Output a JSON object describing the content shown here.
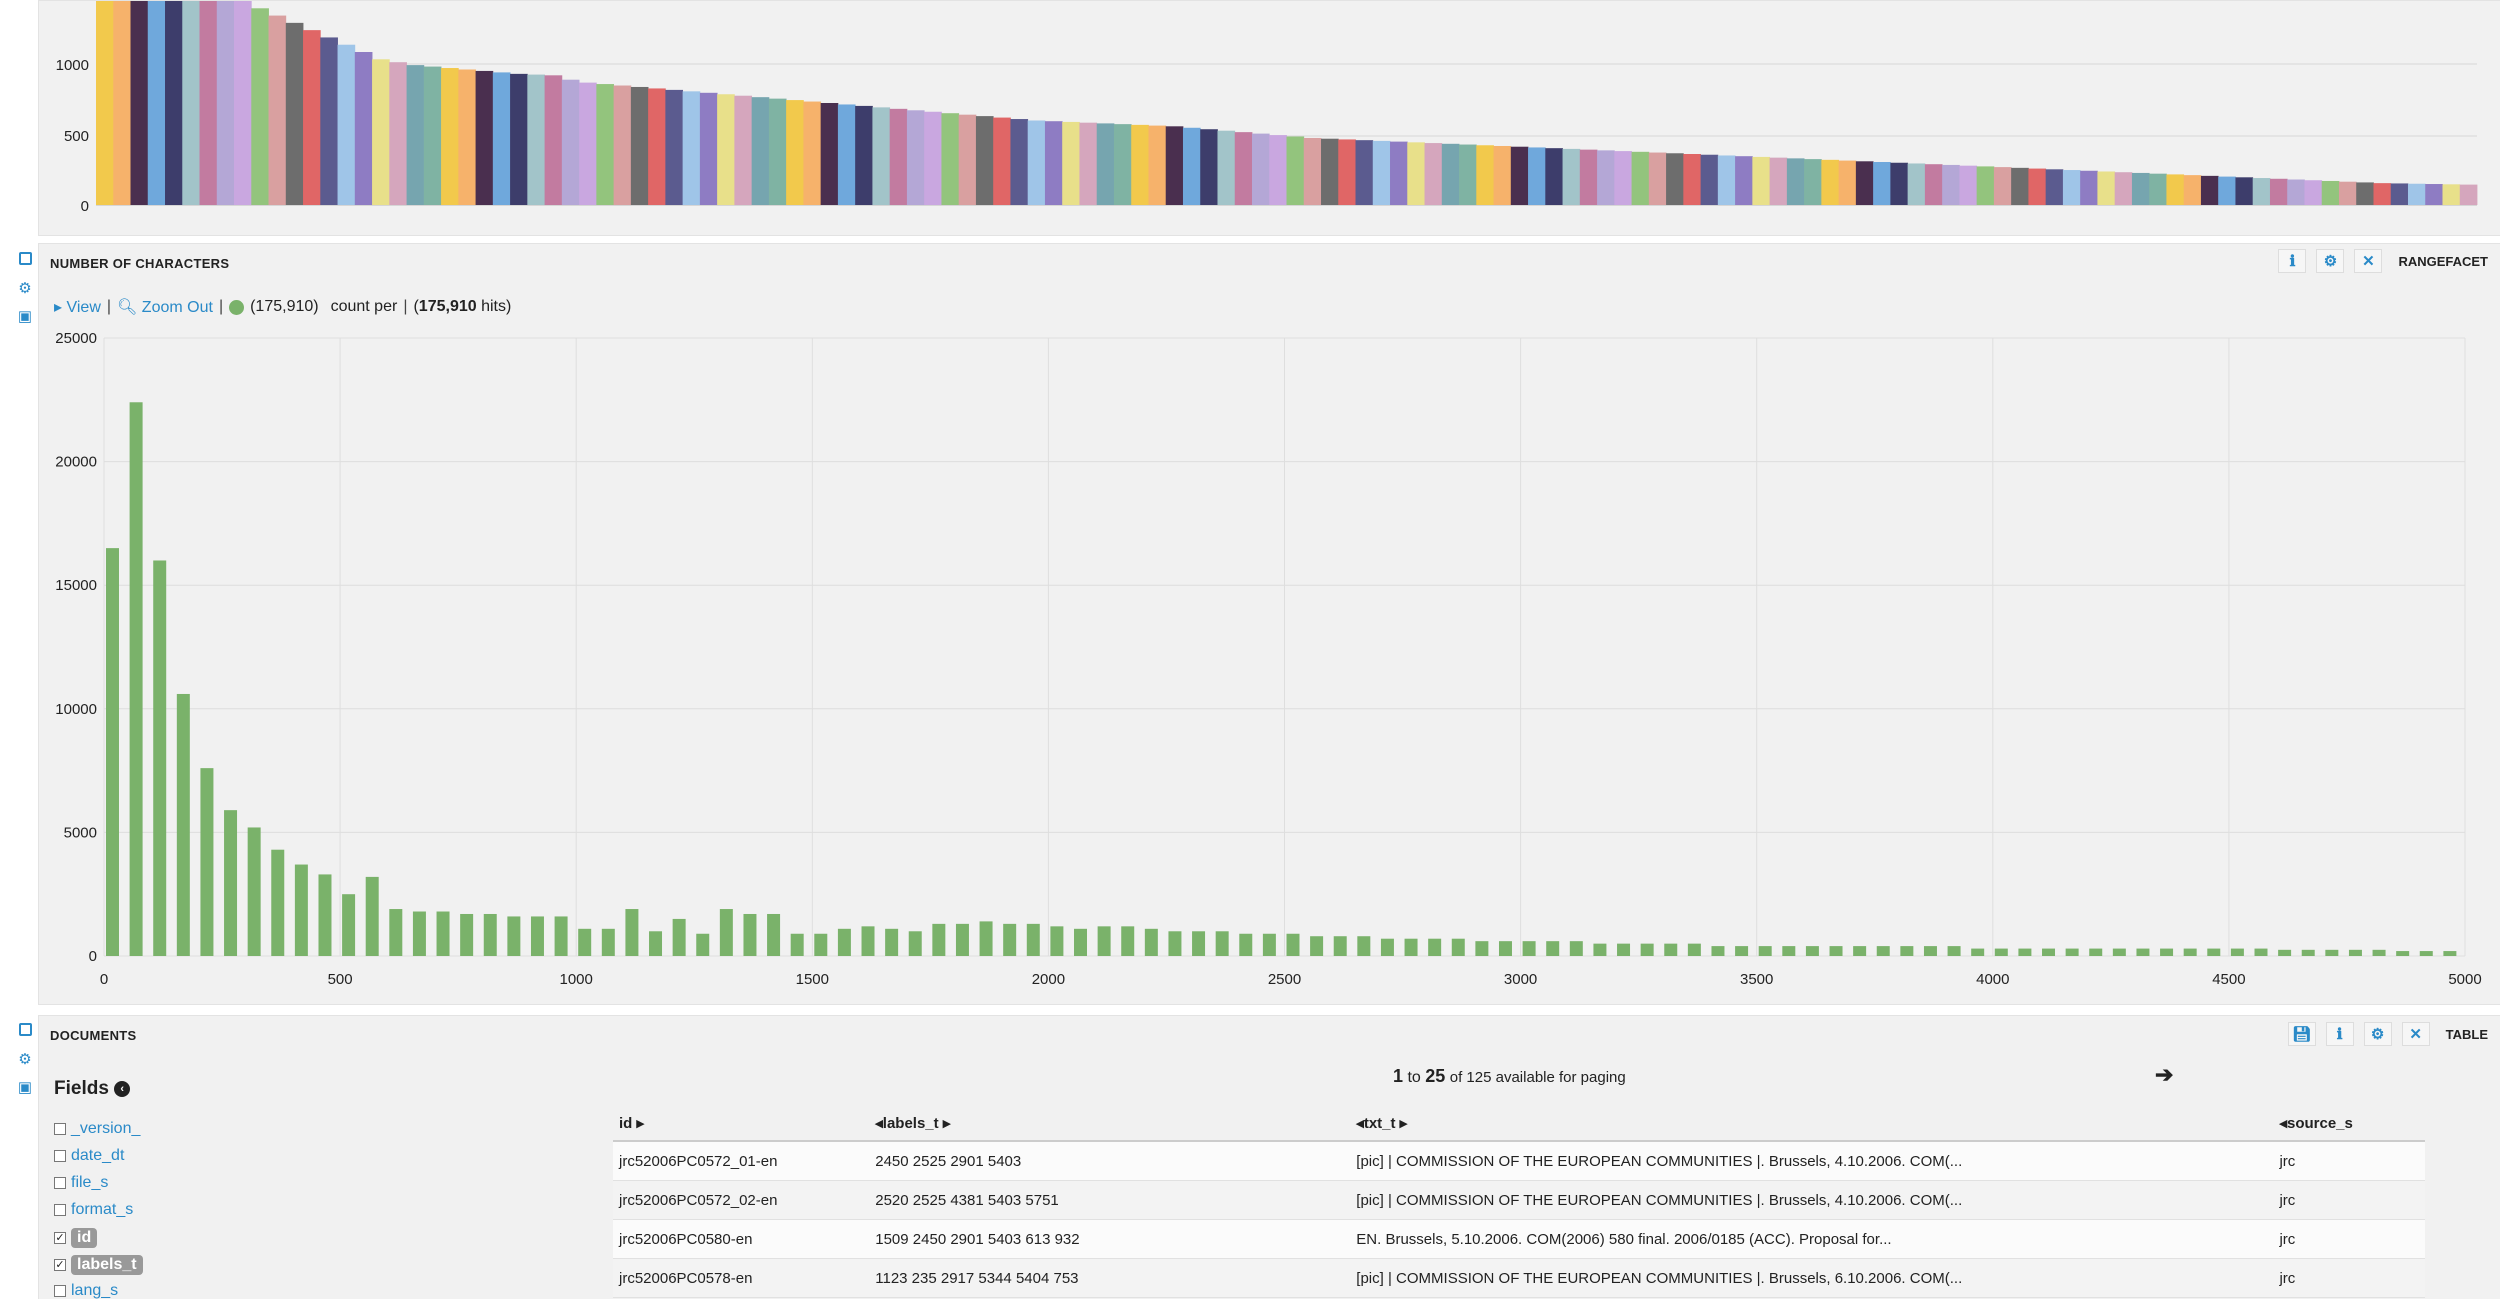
{
  "top_chart": {
    "y_ticks": [
      "1000",
      "500",
      "0"
    ]
  },
  "characters_panel": {
    "title": "NUMBER OF CHARACTERS",
    "type_label": "RANGEFACET",
    "toolbar": {
      "view_label": "View",
      "zoom_out_label": "Zoom Out",
      "legend_count": "(175,910)",
      "count_per": "count per",
      "hits_open": "(",
      "hits_value": "175,910",
      "hits_close": " hits)"
    }
  },
  "documents_panel": {
    "title": "DOCUMENTS",
    "type_label": "TABLE",
    "fields_title": "Fields",
    "fields": [
      {
        "name": "_version_",
        "checked": false
      },
      {
        "name": "date_dt",
        "checked": false
      },
      {
        "name": "file_s",
        "checked": false
      },
      {
        "name": "format_s",
        "checked": false
      },
      {
        "name": "id",
        "checked": true
      },
      {
        "name": "labels_t",
        "checked": true
      },
      {
        "name": "lang_s",
        "checked": false
      }
    ],
    "paging": {
      "from": "1",
      "to_word": "to",
      "to": "25",
      "rest": "of 125 available for paging"
    },
    "columns": [
      "id",
      "labels_t",
      "txt_t",
      "source_s"
    ],
    "rows": [
      [
        "jrc52006PC0572_01-en",
        "2450 2525 2901 5403",
        "[pic] | COMMISSION OF THE EUROPEAN COMMUNITIES |. Brussels, 4.10.2006. COM(...",
        "jrc"
      ],
      [
        "jrc52006PC0572_02-en",
        "2520 2525 4381 5403 5751",
        "[pic] | COMMISSION OF THE EUROPEAN COMMUNITIES |. Brussels, 4.10.2006. COM(...",
        "jrc"
      ],
      [
        "jrc52006PC0580-en",
        "1509 2450 2901 5403 613 932",
        "EN. Brussels, 5.10.2006. COM(2006) 580 final. 2006/0185 (ACC). Proposal for...",
        "jrc"
      ],
      [
        "jrc52006PC0578-en",
        "1123 235 2917 5344 5404 753",
        "[pic] | COMMISSION OF THE EUROPEAN COMMUNITIES |. Brussels, 6.10.2006. COM(...",
        "jrc"
      ]
    ]
  },
  "colors": {
    "accent": "#2a8ac8",
    "bar_green": "#7ab26a",
    "panel_bg": "#f1f1f1"
  },
  "chart_data": [
    {
      "type": "bar",
      "title": "",
      "xlabel": "",
      "ylabel": "",
      "ylim": [
        0,
        1400
      ],
      "y_ticks": [
        0,
        500,
        1000
      ],
      "note": "colored terms histogram, descending values, truncated at top of viewport",
      "values": [
        1400,
        1400,
        1400,
        1400,
        1400,
        1400,
        1400,
        1400,
        1400,
        1350,
        1300,
        1250,
        1200,
        1150,
        1100,
        1050,
        1000,
        980,
        960,
        950,
        940,
        930,
        920,
        910,
        900,
        895,
        890,
        860,
        840,
        830,
        820,
        810,
        800,
        790,
        780,
        770,
        760,
        750,
        740,
        730,
        720,
        710,
        700,
        690,
        680,
        670,
        660,
        650,
        640,
        630,
        620,
        610,
        600,
        590,
        580,
        575,
        570,
        565,
        560,
        555,
        550,
        545,
        540,
        530,
        520,
        510,
        500,
        490,
        480,
        470,
        460,
        455,
        450,
        445,
        440,
        435,
        430,
        425,
        420,
        415,
        410,
        405,
        400,
        395,
        390,
        385,
        380,
        375,
        370,
        365,
        360,
        355,
        350,
        345,
        340,
        335,
        330,
        325,
        320,
        315,
        310,
        305,
        300,
        295,
        290,
        285,
        280,
        275,
        270,
        265,
        260,
        255,
        250,
        245,
        240,
        235,
        230,
        225,
        220,
        215,
        210,
        205,
        200,
        195,
        190,
        185,
        180,
        175,
        170,
        165,
        160,
        155,
        150,
        148,
        146,
        144,
        142,
        140
      ]
    },
    {
      "type": "bar",
      "title": "NUMBER OF CHARACTERS",
      "xlabel": "",
      "ylabel": "",
      "xlim": [
        0,
        5000
      ],
      "ylim": [
        0,
        25000
      ],
      "x_ticks": [
        0,
        500,
        1000,
        1500,
        2000,
        2500,
        3000,
        3500,
        4000,
        4500,
        5000
      ],
      "y_ticks": [
        0,
        5000,
        10000,
        15000,
        20000,
        25000
      ],
      "bin_width": 50,
      "series": [
        {
          "values": [
            16500,
            22400,
            16000,
            10600,
            7600,
            5900,
            5200,
            4300,
            3700,
            3300,
            2500,
            3200,
            1900,
            1800,
            1800,
            1700,
            1700,
            1600,
            1600,
            1600,
            1100,
            1100,
            1900,
            1000,
            1500,
            900,
            1900,
            1700,
            1700,
            900,
            900,
            1100,
            1200,
            1100,
            1000,
            1300,
            1300,
            1400,
            1300,
            1300,
            1200,
            1100,
            1200,
            1200,
            1100,
            1000,
            1000,
            1000,
            900,
            900,
            900,
            800,
            800,
            800,
            700,
            700,
            700,
            700,
            600,
            600,
            600,
            600,
            600,
            500,
            500,
            500,
            500,
            500,
            400,
            400,
            400,
            400,
            400,
            400,
            400,
            400,
            400,
            400,
            400,
            300,
            300,
            300,
            300,
            300,
            300,
            300,
            300,
            300,
            300,
            300,
            300,
            300,
            250,
            250,
            250,
            250,
            250,
            200,
            200,
            200
          ]
        }
      ]
    }
  ]
}
